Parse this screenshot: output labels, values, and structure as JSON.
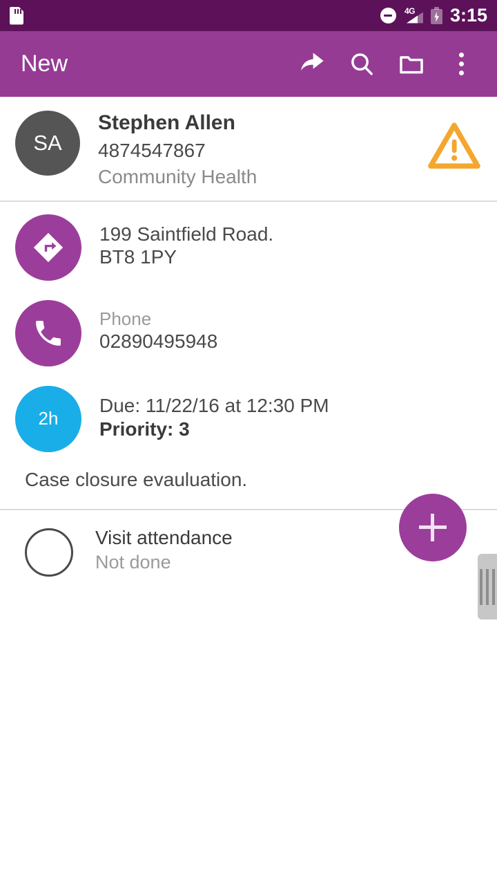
{
  "status_bar": {
    "sd_icon": "sd-card-icon",
    "dnd_icon": "do-not-disturb-icon",
    "network_label": "4G",
    "signal_icon": "signal-bars-icon",
    "battery_icon": "battery-charging-icon",
    "time": "3:15",
    "background": "#5C1159"
  },
  "app_bar": {
    "title": "New",
    "background": "#953B94",
    "actions": [
      {
        "name": "share-icon",
        "label": "Share"
      },
      {
        "name": "search-icon",
        "label": "Search"
      },
      {
        "name": "folder-icon",
        "label": "Folder"
      },
      {
        "name": "overflow-menu-icon",
        "label": "More options"
      }
    ]
  },
  "contact": {
    "initials": "SA",
    "name": "Stephen Allen",
    "id": "4874547867",
    "organization": "Community Health",
    "warning_icon": "warning-triangle-icon",
    "warning_color": "#F5A62E",
    "avatar_color": "#555555"
  },
  "details": {
    "address": {
      "icon": "directions-icon",
      "line1": "199 Saintfield Road.",
      "line2": "BT8 1PY"
    },
    "phone": {
      "icon": "phone-icon",
      "label": "Phone",
      "number": "02890495948"
    },
    "schedule": {
      "badge": "2h",
      "badge_color": "#19AEE8",
      "due": "Due: 11/22/16 at 12:30 PM",
      "priority": "Priority: 3"
    },
    "note": "Case closure evauluation."
  },
  "task": {
    "checkbox": "task-checkbox-unchecked",
    "title": "Visit attendance",
    "status": "Not done"
  },
  "fab": {
    "icon": "plus-icon",
    "label": "Add",
    "color": "#9B3E9B"
  },
  "scrollbar": {
    "name": "scroll-thumb"
  }
}
